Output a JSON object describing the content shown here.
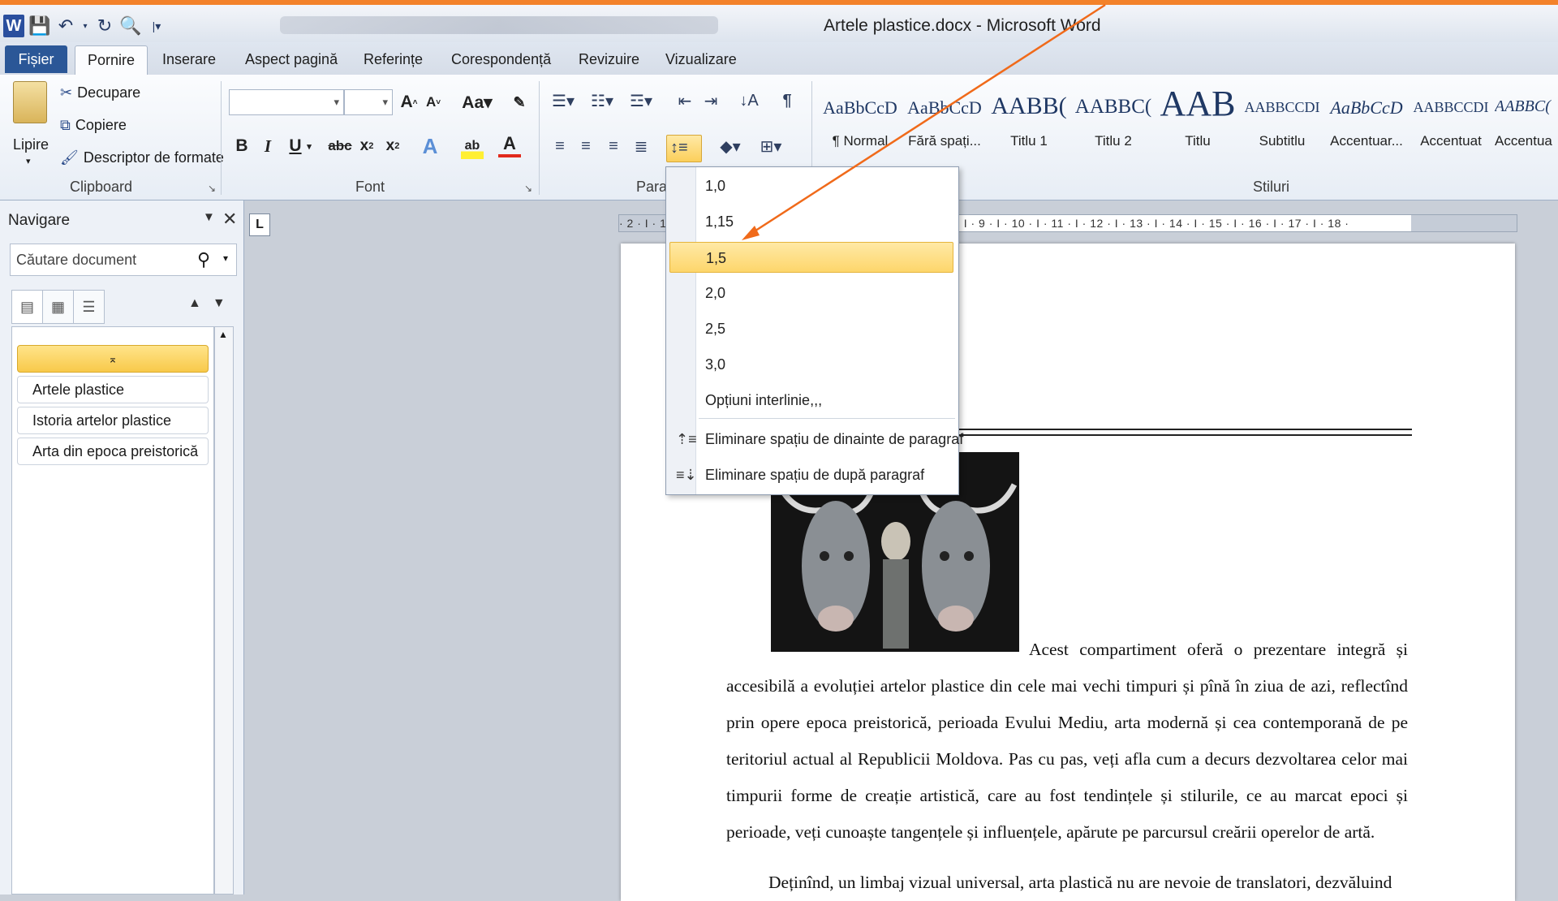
{
  "window": {
    "title": "Artele plastice.docx - Microsoft Word",
    "accent_color": "#f3822a",
    "file_tab_color": "#2b5797"
  },
  "qat": {
    "icons": [
      "word-logo-icon",
      "save-icon",
      "undo-icon",
      "redo-icon",
      "print-preview-icon",
      "customize-icon"
    ],
    "word_letter": "W"
  },
  "tabs": [
    {
      "label": "Fișier",
      "active": false
    },
    {
      "label": "Pornire",
      "active": true
    },
    {
      "label": "Inserare",
      "active": false
    },
    {
      "label": "Aspect pagină",
      "active": false
    },
    {
      "label": "Referințe",
      "active": false
    },
    {
      "label": "Corespondență",
      "active": false
    },
    {
      "label": "Revizuire",
      "active": false
    },
    {
      "label": "Vizualizare",
      "active": false
    }
  ],
  "ribbon": {
    "clipboard": {
      "label": "Clipboard",
      "paste": "Lipire",
      "cut": "Decupare",
      "copy": "Copiere",
      "format_painter": "Descriptor de formate"
    },
    "font": {
      "label": "Font"
    },
    "paragraph": {
      "label": "Paragraf"
    },
    "styles": {
      "label": "Stiluri",
      "items": [
        {
          "sample": "AaBbCcD",
          "name": "¶ Normal"
        },
        {
          "sample": "AaBbCcD",
          "name": "Fără spați..."
        },
        {
          "sample": "AABB(",
          "name": "Titlu 1"
        },
        {
          "sample": "AABBC(",
          "name": "Titlu 2"
        },
        {
          "sample": "AAB",
          "name": "Titlu"
        },
        {
          "sample": "AABBCCDI",
          "name": "Subtitlu"
        },
        {
          "sample": "AaBbCcD",
          "name": "Accentuar..."
        },
        {
          "sample": "AABBCCDI",
          "name": "Accentuat"
        },
        {
          "sample": "AABBC(",
          "name": "Accentua"
        }
      ]
    }
  },
  "line_spacing_menu": {
    "options": [
      {
        "label": "1,0",
        "selected": false
      },
      {
        "label": "1,15",
        "selected": false
      },
      {
        "label": "1,5",
        "selected": true
      },
      {
        "label": "2,0",
        "selected": false
      },
      {
        "label": "2,5",
        "selected": false
      },
      {
        "label": "3,0",
        "selected": false
      }
    ],
    "more_options": "Opțiuni interlinie,,,",
    "remove_before": "Eliminare spațiu de dinainte de paragraf",
    "remove_after": "Eliminare spațiu de după paragraf"
  },
  "navigation": {
    "title": "Navigare",
    "search_placeholder": "Căutare document",
    "headings": [
      "Artele plastice",
      "Istoria artelor plastice",
      "Arta din epoca preistorică"
    ]
  },
  "ruler": {
    "text": "· 2 · I ·  1 · I ·  · I · 1 · I · 2 · I · 3 · I · 4 · I · 5 · I · 6 · I · 7 · I · 8 · I · 9 · I · 10 · I · 11 · I · 12 · I · 13 · I · 14 · I · 15 · I · 16 · I · 17 · I · 18 ·"
  },
  "document": {
    "paragraph1_first": "Acest compartiment oferă o prezentare integră și",
    "paragraph1_rest": "accesibilă a evoluției artelor plastice din cele mai vechi timpuri și pînă în ziua de azi, reflectînd prin opere epoca preistorică, perioada Evului Mediu, arta modernă și cea contemporană de pe teritoriul actual al Republicii Moldova. Pas cu pas, veți afla cum a decurs dezvoltarea celor mai timpurii forme de creație artistică, care au fost tendințele și stilurile, ce au marcat epoci și perioade, veți cunoaște tangențele și influențele, apărute pe parcursul creării operelor de artă.",
    "paragraph2": "Deținînd, un limbaj vizual universal, arta plastică nu are nevoie de translatori, dezvăluind"
  }
}
